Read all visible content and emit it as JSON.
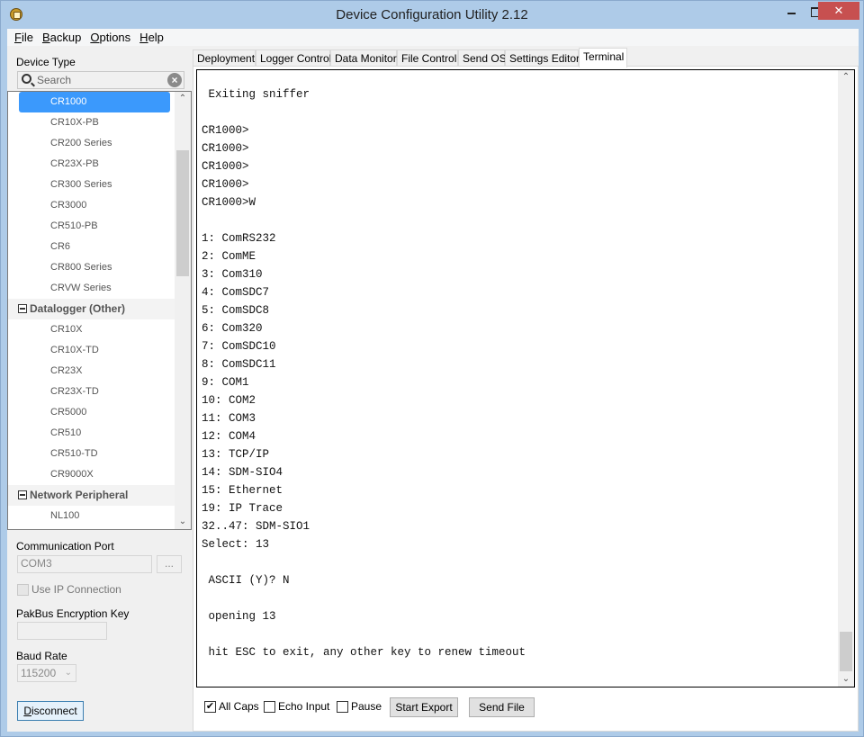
{
  "window": {
    "title": "Device Configuration Utility 2.12",
    "controls": {
      "minimize": "minimize",
      "maximize": "maximize",
      "close": "✕"
    }
  },
  "menu": [
    {
      "label": "File",
      "accel": "F"
    },
    {
      "label": "Backup",
      "accel": "B"
    },
    {
      "label": "Options",
      "accel": "O"
    },
    {
      "label": "Help",
      "accel": "H"
    }
  ],
  "sidebar": {
    "device_type_label": "Device Type",
    "search_placeholder": "Search",
    "tree": [
      {
        "type": "item",
        "label": "CR1000",
        "selected": true
      },
      {
        "type": "item",
        "label": "CR10X-PB"
      },
      {
        "type": "item",
        "label": "CR200 Series"
      },
      {
        "type": "item",
        "label": "CR23X-PB"
      },
      {
        "type": "item",
        "label": "CR300 Series"
      },
      {
        "type": "item",
        "label": "CR3000"
      },
      {
        "type": "item",
        "label": "CR510-PB"
      },
      {
        "type": "item",
        "label": "CR6"
      },
      {
        "type": "item",
        "label": "CR800 Series"
      },
      {
        "type": "item",
        "label": "CRVW Series"
      },
      {
        "type": "group",
        "label": "Datalogger (Other)"
      },
      {
        "type": "item",
        "label": "CR10X"
      },
      {
        "type": "item",
        "label": "CR10X-TD"
      },
      {
        "type": "item",
        "label": "CR23X"
      },
      {
        "type": "item",
        "label": "CR23X-TD"
      },
      {
        "type": "item",
        "label": "CR5000"
      },
      {
        "type": "item",
        "label": "CR510"
      },
      {
        "type": "item",
        "label": "CR510-TD"
      },
      {
        "type": "item",
        "label": "CR9000X"
      },
      {
        "type": "group",
        "label": "Network Peripheral"
      },
      {
        "type": "item",
        "label": "NL100"
      }
    ],
    "comm_port_label": "Communication Port",
    "comm_port_value": "COM3",
    "browse_label": "...",
    "use_ip_label": "Use IP Connection",
    "use_ip_checked": false,
    "pakbus_key_label": "PakBus Encryption Key",
    "pakbus_key_value": "",
    "baud_rate_label": "Baud Rate",
    "baud_rate_value": "115200",
    "disconnect_label": "Disconnect"
  },
  "tabs": [
    {
      "label": "Deployment"
    },
    {
      "label": "Logger Control"
    },
    {
      "label": "Data Monitor"
    },
    {
      "label": "File Control"
    },
    {
      "label": "Send OS"
    },
    {
      "label": "Settings Editor"
    },
    {
      "label": "Terminal",
      "active": true
    }
  ],
  "terminal": {
    "lines": [
      " Exiting sniffer",
      "",
      "CR1000>",
      "CR1000>",
      "CR1000>",
      "CR1000>",
      "CR1000>W",
      "",
      "1: ComRS232",
      "2: ComME",
      "3: Com310",
      "4: ComSDC7",
      "5: ComSDC8",
      "6: Com320",
      "7: ComSDC10",
      "8: ComSDC11",
      "9: COM1",
      "10: COM2",
      "11: COM3",
      "12: COM4",
      "13: TCP/IP",
      "14: SDM-SIO4",
      "15: Ethernet",
      "19: IP Trace",
      "32..47: SDM-SIO1",
      "Select: 13",
      "",
      " ASCII (Y)? N",
      "",
      " opening 13",
      "",
      " hit ESC to exit, any other key to renew timeout"
    ],
    "all_caps_label": "All Caps",
    "all_caps_checked": true,
    "echo_input_label": "Echo Input",
    "echo_input_checked": false,
    "pause_label": "Pause",
    "pause_checked": false,
    "start_export_label": "Start Export",
    "send_file_label": "Send File"
  }
}
